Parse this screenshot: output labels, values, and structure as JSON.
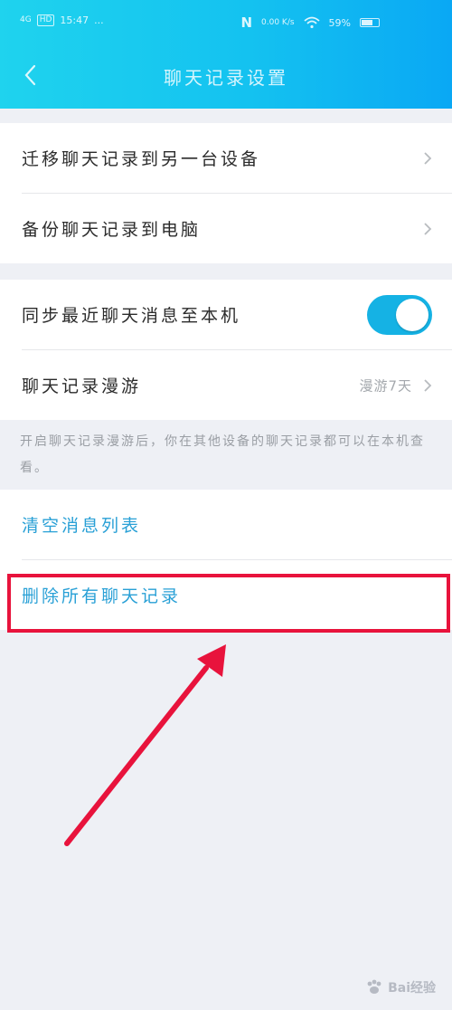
{
  "status_bar": {
    "signal": "4G",
    "hd": "HD",
    "time": "15:47",
    "dots": "...",
    "nfc": "N",
    "speed": "0.00 K/s",
    "battery": "59%"
  },
  "header": {
    "title": "聊天记录设置"
  },
  "group1": {
    "items": [
      {
        "label": "迁移聊天记录到另一台设备"
      },
      {
        "label": "备份聊天记录到电脑"
      }
    ]
  },
  "group2": {
    "sync_label": "同步最近聊天消息至本机",
    "sync_enabled": true,
    "roaming_label": "聊天记录漫游",
    "roaming_value": "漫游7天"
  },
  "hint": "开启聊天记录漫游后，你在其他设备的聊天记录都可以在本机查看。",
  "group3": {
    "clear_label": "清空消息列表",
    "delete_label": "删除所有聊天记录"
  },
  "annotation": {
    "highlight_color": "#e8133c"
  },
  "watermark": {
    "text": "Bai经验"
  },
  "colors": {
    "header_start": "#1fd3ee",
    "header_end": "#0aa8f4",
    "toggle_on": "#15b2e4",
    "link": "#29a0d6"
  }
}
